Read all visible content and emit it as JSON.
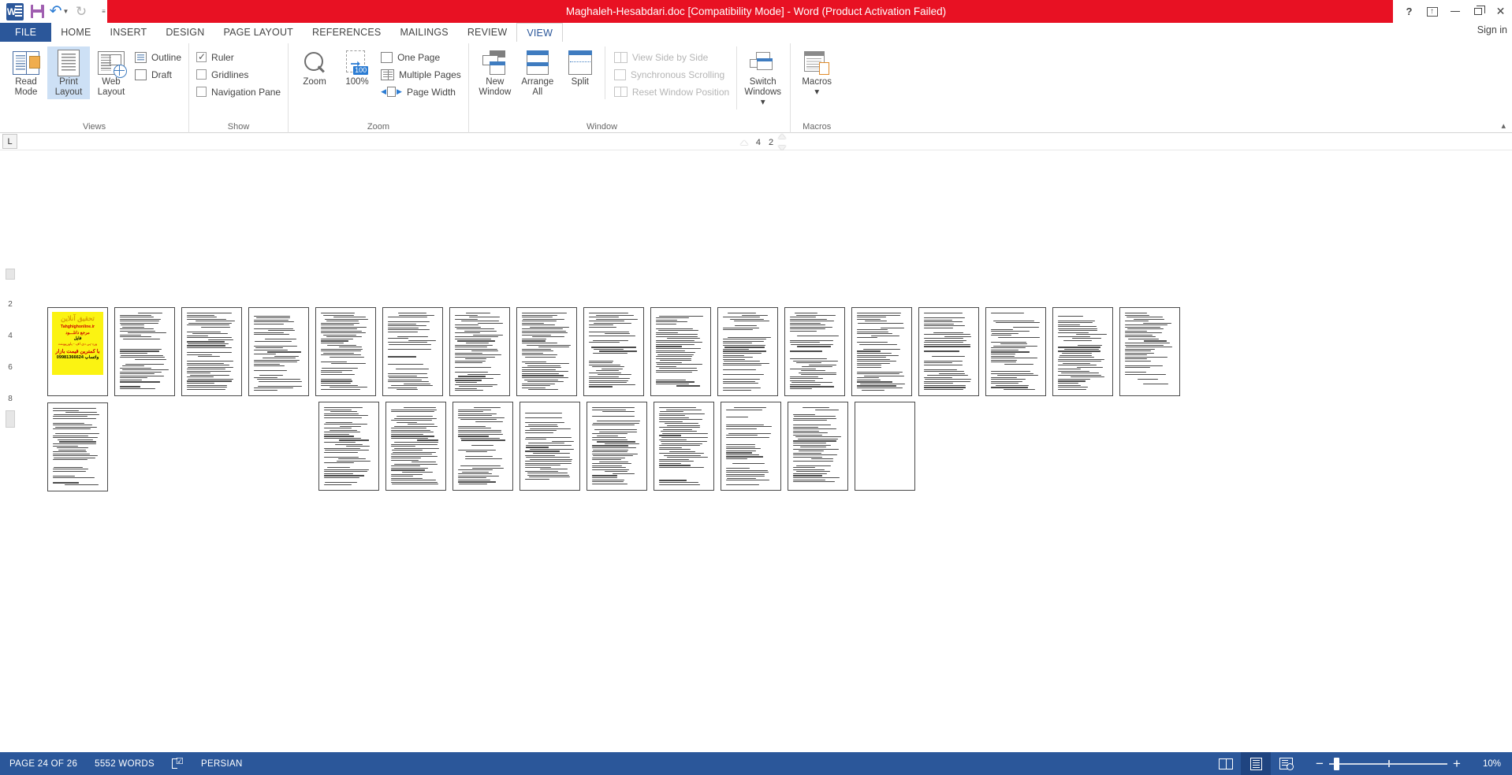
{
  "titlebar": {
    "document_title": "Maghaleh-Hesabdari.doc [Compatibility Mode]  -  Word (Product Activation Failed)",
    "quick_access": [
      {
        "name": "word-logo",
        "label": "W"
      },
      {
        "name": "save-icon",
        "label": "Save"
      },
      {
        "name": "undo-icon",
        "label": "Undo"
      },
      {
        "name": "redo-icon",
        "label": "Redo"
      },
      {
        "name": "customize-qat-icon",
        "label": "Customize Quick Access Toolbar"
      }
    ],
    "controls": {
      "help": "?",
      "ribbon_display": "Ribbon Display Options",
      "minimize": "Minimize",
      "restore": "Restore Down",
      "close": "✕"
    },
    "signin": "Sign in"
  },
  "tabs": [
    {
      "label": "FILE",
      "active": false,
      "file": true
    },
    {
      "label": "HOME",
      "active": false
    },
    {
      "label": "INSERT",
      "active": false
    },
    {
      "label": "DESIGN",
      "active": false
    },
    {
      "label": "PAGE LAYOUT",
      "active": false
    },
    {
      "label": "REFERENCES",
      "active": false
    },
    {
      "label": "MAILINGS",
      "active": false
    },
    {
      "label": "REVIEW",
      "active": false
    },
    {
      "label": "VIEW",
      "active": true
    }
  ],
  "ribbon": {
    "groups": [
      {
        "name": "views",
        "label": "Views",
        "big_buttons": [
          {
            "label_line1": "Read",
            "label_line2": "Mode",
            "selected": false
          },
          {
            "label_line1": "Print",
            "label_line2": "Layout",
            "selected": true
          },
          {
            "label_line1": "Web",
            "label_line2": "Layout",
            "selected": false
          }
        ],
        "small_items": [
          {
            "label": "Outline",
            "kind": "icon",
            "disabled": false
          },
          {
            "label": "Draft",
            "kind": "icon",
            "disabled": false
          }
        ]
      },
      {
        "name": "show",
        "label": "Show",
        "checks": [
          {
            "label": "Ruler",
            "checked": true
          },
          {
            "label": "Gridlines",
            "checked": false
          },
          {
            "label": "Navigation Pane",
            "checked": false
          }
        ]
      },
      {
        "name": "zoom",
        "label": "Zoom",
        "big_buttons": [
          {
            "label_line1": "Zoom",
            "label_line2": ""
          },
          {
            "label_line1": "100%",
            "label_line2": ""
          }
        ],
        "small_items": [
          {
            "label": "One Page"
          },
          {
            "label": "Multiple Pages"
          },
          {
            "label": "Page Width"
          }
        ]
      },
      {
        "name": "window",
        "label": "Window",
        "big_buttons": [
          {
            "label_line1": "New",
            "label_line2": "Window"
          },
          {
            "label_line1": "Arrange",
            "label_line2": "All"
          },
          {
            "label_line1": "Split",
            "label_line2": ""
          }
        ],
        "small_items": [
          {
            "label": "View Side by Side",
            "disabled": true
          },
          {
            "label": "Synchronous Scrolling",
            "disabled": true
          },
          {
            "label": "Reset Window Position",
            "disabled": true
          }
        ],
        "extra_buttons": [
          {
            "label_line1": "Switch",
            "label_line2": "Windows ▾"
          }
        ]
      },
      {
        "name": "macros",
        "label": "Macros",
        "big_buttons": [
          {
            "label_line1": "Macros",
            "label_line2": "▾"
          }
        ]
      }
    ],
    "collapse_label": "▴"
  },
  "ruler": {
    "tab_selector": "L",
    "marks": [
      "4",
      "2"
    ]
  },
  "vertical_ruler": {
    "marks": [
      "2",
      "4",
      "6",
      "8"
    ]
  },
  "document": {
    "pages_row1": [
      {
        "type": "cover"
      },
      {
        "type": "text",
        "seed": 2
      },
      {
        "type": "text",
        "seed": 3
      },
      {
        "type": "text",
        "seed": 4
      },
      {
        "type": "text",
        "seed": 5
      },
      {
        "type": "text",
        "seed": 6
      },
      {
        "type": "text",
        "seed": 7
      },
      {
        "type": "text",
        "seed": 8
      },
      {
        "type": "text",
        "seed": 9
      },
      {
        "type": "text",
        "seed": 10
      },
      {
        "type": "text",
        "seed": 11
      },
      {
        "type": "text",
        "seed": 12
      },
      {
        "type": "text",
        "seed": 13
      },
      {
        "type": "text",
        "seed": 14
      },
      {
        "type": "text",
        "seed": 15
      },
      {
        "type": "text",
        "seed": 16
      },
      {
        "type": "text",
        "seed": 17
      },
      {
        "type": "text",
        "seed": 18
      }
    ],
    "pages_row2": [
      {
        "type": "text",
        "seed": 19
      },
      {
        "type": "text",
        "seed": 20
      },
      {
        "type": "text",
        "seed": 21
      },
      {
        "type": "text",
        "seed": 22
      },
      {
        "type": "text",
        "seed": 23
      },
      {
        "type": "text",
        "seed": 24
      },
      {
        "type": "text",
        "seed": 25
      },
      {
        "type": "text",
        "seed": 26
      },
      {
        "type": "blank",
        "seed": 27
      }
    ],
    "cover": {
      "line1": "تحقیق آنلاین",
      "line2": "Tahghighonline.ir",
      "line3": "مرجع دانلـــود",
      "line4": "فایل",
      "line5": "ورد-پی دی اف - پاورپوینت",
      "line6": "با کمترین قیمت بازار",
      "line7": "09981366624 واتساپ"
    }
  },
  "statusbar": {
    "page_info": "PAGE 24 OF 26",
    "word_count": "5552 WORDS",
    "proofing": "proofing-icon",
    "language": "PERSIAN",
    "view_buttons": [
      {
        "name": "read-mode-view-button",
        "active": false
      },
      {
        "name": "print-layout-view-button",
        "active": true
      },
      {
        "name": "web-layout-view-button",
        "active": false
      }
    ],
    "zoom": {
      "minus": "−",
      "plus": "+",
      "level": "10%",
      "thumb_position_pct": 4
    }
  },
  "colors": {
    "titlebar_red": "#e81123",
    "accent_blue": "#2b579a",
    "selected_blue": "#cde0f5",
    "cover_yellow": "#fbf312",
    "cover_red": "#cc0000"
  }
}
